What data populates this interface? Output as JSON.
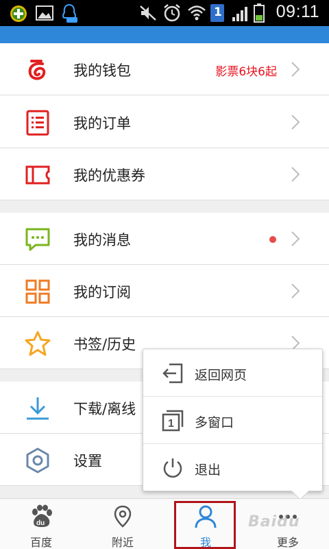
{
  "status_bar": {
    "time": "09:11",
    "sim_badge": "1",
    "icons": [
      "app-notify-icon",
      "gallery-icon",
      "qq-icon",
      "mute-icon",
      "alarm-icon",
      "wifi-icon",
      "sim-icon",
      "signal-icon",
      "battery-icon"
    ]
  },
  "menu": {
    "items": [
      {
        "label": "我的钱包",
        "icon": "wallet-icon",
        "promo": "影票6块6起"
      },
      {
        "label": "我的订单",
        "icon": "orders-icon"
      },
      {
        "label": "我的优惠券",
        "icon": "coupon-icon"
      },
      {
        "label": "我的消息",
        "icon": "message-icon",
        "has_unread_dot": true
      },
      {
        "label": "我的订阅",
        "icon": "subscription-icon"
      },
      {
        "label": "书签/历史",
        "icon": "bookmark-star-icon"
      },
      {
        "label": "下载/离线",
        "icon": "download-icon"
      },
      {
        "label": "设置",
        "icon": "settings-gear-icon"
      }
    ]
  },
  "popup": {
    "items": [
      {
        "label": "返回网页",
        "icon": "back-to-page-icon"
      },
      {
        "label": "多窗口",
        "icon": "multi-window-icon",
        "count": "1"
      },
      {
        "label": "退出",
        "icon": "power-icon"
      }
    ]
  },
  "bottom_nav": {
    "tabs": [
      {
        "label": "百度",
        "icon": "baidu-paw-icon"
      },
      {
        "label": "附近",
        "icon": "location-pin-icon"
      },
      {
        "label": "我",
        "icon": "person-icon",
        "active": true
      },
      {
        "label": "更多",
        "icon": "more-dots-icon"
      }
    ],
    "watermark": "Baidu"
  },
  "colors": {
    "header_blue": "#2e87d8",
    "promo_red": "#e8121f",
    "highlight_red": "#b0141a"
  }
}
